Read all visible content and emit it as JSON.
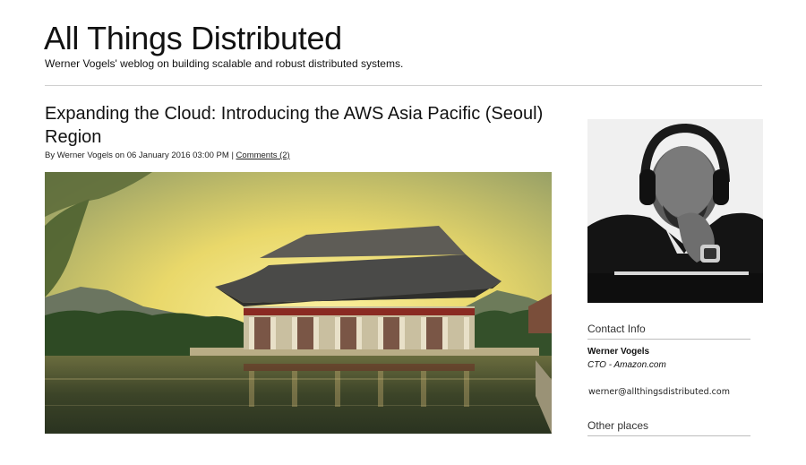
{
  "site": {
    "title": "All Things Distributed",
    "tagline": "Werner Vogels' weblog on building scalable and robust distributed systems."
  },
  "post": {
    "title": "Expanding the Cloud: Introducing the AWS Asia Pacific (Seoul) Region",
    "byline": "By Werner Vogels on 06 January 2016 03:00 PM",
    "separator": "|",
    "comments_link": "Comments (2)"
  },
  "sidebar": {
    "contact_heading": "Contact Info",
    "name": "Werner Vogels",
    "role": "CTO - Amazon.com",
    "email": "werner@allthingsdistributed.com",
    "other_heading": "Other places"
  },
  "colors": {
    "sky_top": "#8f9a6a",
    "sky_glow": "#f2e27a",
    "water": "#3f4a2c",
    "roof": "#4a4a48",
    "pavilion_red": "#8a2a22"
  }
}
